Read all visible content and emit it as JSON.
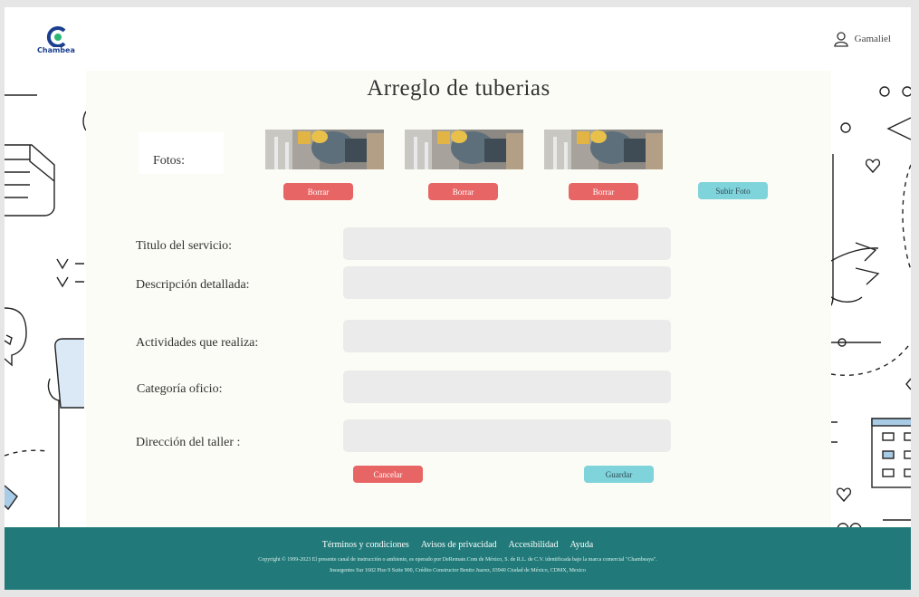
{
  "brand": {
    "name": "Chambea",
    "accent": "#1b3f8f",
    "secondary": "#2bb673"
  },
  "header": {
    "user_name": "Gamaliel",
    "user_icon": "user-icon"
  },
  "page": {
    "title": "Arreglo de tuberias"
  },
  "photos": {
    "label": "Fotos:",
    "items": [
      {
        "delete_label": "Borrar"
      },
      {
        "delete_label": "Borrar"
      },
      {
        "delete_label": "Borrar"
      }
    ],
    "upload_label": "Subir Foto"
  },
  "form": {
    "fields": [
      {
        "label": "Titulo del servicio:",
        "value": ""
      },
      {
        "label": "Descripción detallada:",
        "value": ""
      },
      {
        "label": "Actividades que realiza:",
        "value": ""
      },
      {
        "label": "Categoría oficio:",
        "value": ""
      },
      {
        "label": "Dirección del taller :",
        "value": ""
      }
    ],
    "cancel_label": "Cancelar",
    "save_label": "Guardar"
  },
  "colors": {
    "danger": "#e86565",
    "primary": "#7fd3da",
    "footer": "#217a79"
  },
  "footer": {
    "links": [
      "Términos y condiciones",
      "Avisos de privacidad",
      "Accesibilidad",
      "Ayuda"
    ],
    "copyright": "Copyright © 1999-2023 El presente canal de instrucción o ambiente, es operado por DeRemate.Com de México, S. de R.L. de C.V. identificada bajo la marca comercial \"Chambeaya\".",
    "address": "Insurgentes Sur 1602 Piso 9 Suite 900, Crédito Constructor Benito Juarez, 03940 Ciudad de México, CDMX, Mexico"
  }
}
